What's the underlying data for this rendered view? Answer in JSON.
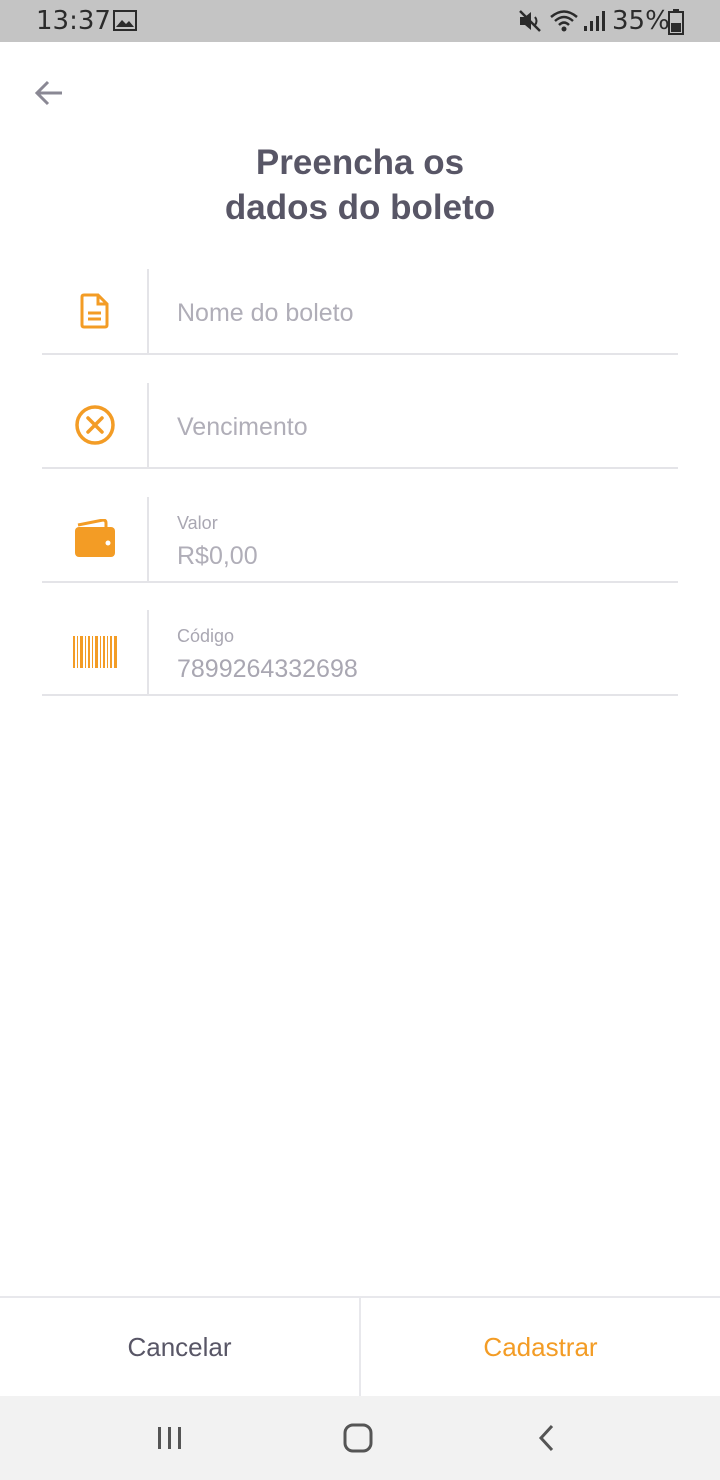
{
  "status_bar": {
    "time": "13:37",
    "battery_percent": "35%",
    "icons": [
      "gallery-icon",
      "mute-icon",
      "wifi-icon",
      "signal-icon",
      "battery-icon"
    ]
  },
  "header": {
    "back_icon": "arrow-left-icon",
    "title_line1": "Preencha os",
    "title_line2": "dados do boleto"
  },
  "form": {
    "name": {
      "icon": "document-icon",
      "placeholder": "Nome do boleto",
      "value": ""
    },
    "due_date": {
      "icon": "close-circle-icon",
      "placeholder": "Vencimento",
      "value": ""
    },
    "amount": {
      "icon": "wallet-icon",
      "label": "Valor",
      "value": "R$0,00"
    },
    "code": {
      "icon": "barcode-icon",
      "label": "Código",
      "value": "7899264332698"
    }
  },
  "actions": {
    "cancel_label": "Cancelar",
    "submit_label": "Cadastrar"
  },
  "nav_bar": {
    "icons": [
      "recent-apps-icon",
      "home-icon",
      "back-icon"
    ]
  },
  "colors": {
    "accent": "#f39c25",
    "title": "#585666",
    "placeholder": "#b0aeb8",
    "status_bar_bg": "#c4c4c4",
    "nav_bar_bg": "#f2f2f2"
  }
}
